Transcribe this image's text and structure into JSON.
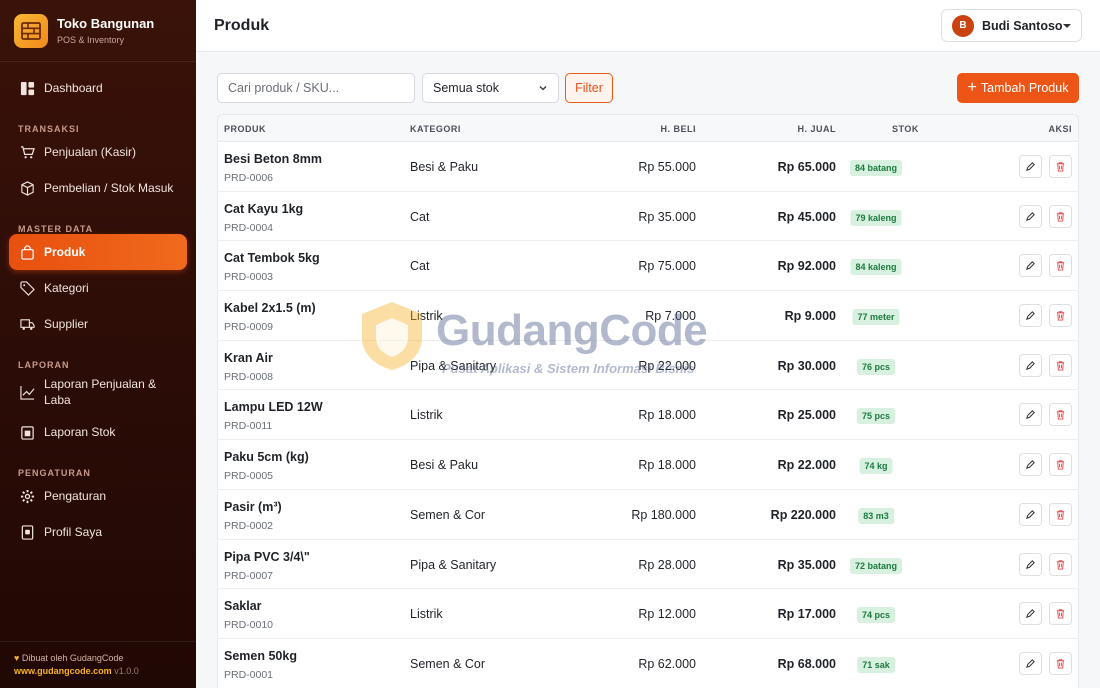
{
  "brand": {
    "title": "Toko Bangunan",
    "subtitle": "POS & Inventory"
  },
  "sidebar": {
    "items": [
      {
        "type": "item",
        "label": "Dashboard",
        "icon": "dashboard-icon",
        "active": false
      },
      {
        "type": "section",
        "label": "TRANSAKSI"
      },
      {
        "type": "item",
        "label": "Penjualan (Kasir)",
        "icon": "cart-icon",
        "active": false
      },
      {
        "type": "item",
        "label": "Pembelian / Stok Masuk",
        "icon": "box-icon",
        "active": false
      },
      {
        "type": "section",
        "label": "MASTER DATA"
      },
      {
        "type": "item",
        "label": "Produk",
        "icon": "bag-icon",
        "active": true
      },
      {
        "type": "item",
        "label": "Kategori",
        "icon": "tag-icon",
        "active": false
      },
      {
        "type": "item",
        "label": "Supplier",
        "icon": "truck-icon",
        "active": false
      },
      {
        "type": "section",
        "label": "LAPORAN"
      },
      {
        "type": "item",
        "label": "Laporan Penjualan & Laba",
        "icon": "chart-line-icon",
        "active": false,
        "tall": true
      },
      {
        "type": "item",
        "label": "Laporan Stok",
        "icon": "clipboard-icon",
        "active": false
      },
      {
        "type": "section",
        "label": "PENGATURAN"
      },
      {
        "type": "item",
        "label": "Pengaturan",
        "icon": "gear-icon",
        "active": false
      },
      {
        "type": "item",
        "label": "Profil Saya",
        "icon": "id-card-icon",
        "active": false
      }
    ],
    "footer": {
      "made_by": "Dibuat oleh GudangCode",
      "url": "www.gudangcode.com",
      "version": "v1.0.0"
    }
  },
  "header": {
    "title": "Produk",
    "user_initial": "B",
    "user_name": "Budi Santoso"
  },
  "toolbar": {
    "search_placeholder": "Cari produk / SKU...",
    "stock_filter_value": "Semua stok",
    "filter_label": "Filter",
    "add_label": "Tambah Produk"
  },
  "table": {
    "headers": {
      "produk": "PRODUK",
      "kategori": "KATEGORI",
      "beli": "H. BELI",
      "jual": "H. JUAL",
      "stok": "STOK",
      "aksi": "AKSI"
    },
    "rows": [
      {
        "name": "Besi Beton 8mm",
        "sku": "PRD-0006",
        "category": "Besi & Paku",
        "buy": "Rp 55.000",
        "sell": "Rp 65.000",
        "stock": "84 batang"
      },
      {
        "name": "Cat Kayu 1kg",
        "sku": "PRD-0004",
        "category": "Cat",
        "buy": "Rp 35.000",
        "sell": "Rp 45.000",
        "stock": "79 kaleng"
      },
      {
        "name": "Cat Tembok 5kg",
        "sku": "PRD-0003",
        "category": "Cat",
        "buy": "Rp 75.000",
        "sell": "Rp 92.000",
        "stock": "84 kaleng"
      },
      {
        "name": "Kabel 2x1.5 (m)",
        "sku": "PRD-0009",
        "category": "Listrik",
        "buy": "Rp 7.000",
        "sell": "Rp 9.000",
        "stock": "77 meter"
      },
      {
        "name": "Kran Air",
        "sku": "PRD-0008",
        "category": "Pipa & Sanitary",
        "buy": "Rp 22.000",
        "sell": "Rp 30.000",
        "stock": "76 pcs"
      },
      {
        "name": "Lampu LED 12W",
        "sku": "PRD-0011",
        "category": "Listrik",
        "buy": "Rp 18.000",
        "sell": "Rp 25.000",
        "stock": "75 pcs"
      },
      {
        "name": "Paku 5cm (kg)",
        "sku": "PRD-0005",
        "category": "Besi & Paku",
        "buy": "Rp 18.000",
        "sell": "Rp 22.000",
        "stock": "74 kg"
      },
      {
        "name": "Pasir (m³)",
        "sku": "PRD-0002",
        "category": "Semen & Cor",
        "buy": "Rp 180.000",
        "sell": "Rp 220.000",
        "stock": "83 m3"
      },
      {
        "name": "Pipa PVC 3/4\\\"",
        "sku": "PRD-0007",
        "category": "Pipa & Sanitary",
        "buy": "Rp 28.000",
        "sell": "Rp 35.000",
        "stock": "72 batang"
      },
      {
        "name": "Saklar",
        "sku": "PRD-0010",
        "category": "Listrik",
        "buy": "Rp 12.000",
        "sell": "Rp 17.000",
        "stock": "74 pcs"
      },
      {
        "name": "Semen 50kg",
        "sku": "PRD-0001",
        "category": "Semen & Cor",
        "buy": "Rp 62.000",
        "sell": "Rp 68.000",
        "stock": "71 sak"
      }
    ]
  },
  "watermark": {
    "title": "GudangCode",
    "subtitle": "Pusat Aplikasi & Sistem Informasi Bisnis"
  },
  "colors": {
    "accent": "#ec5515",
    "sidebar_bg": "#2b0c06",
    "badge_bg": "#d7f0df",
    "badge_text": "#1d7a3f",
    "delete": "#e5484d"
  }
}
